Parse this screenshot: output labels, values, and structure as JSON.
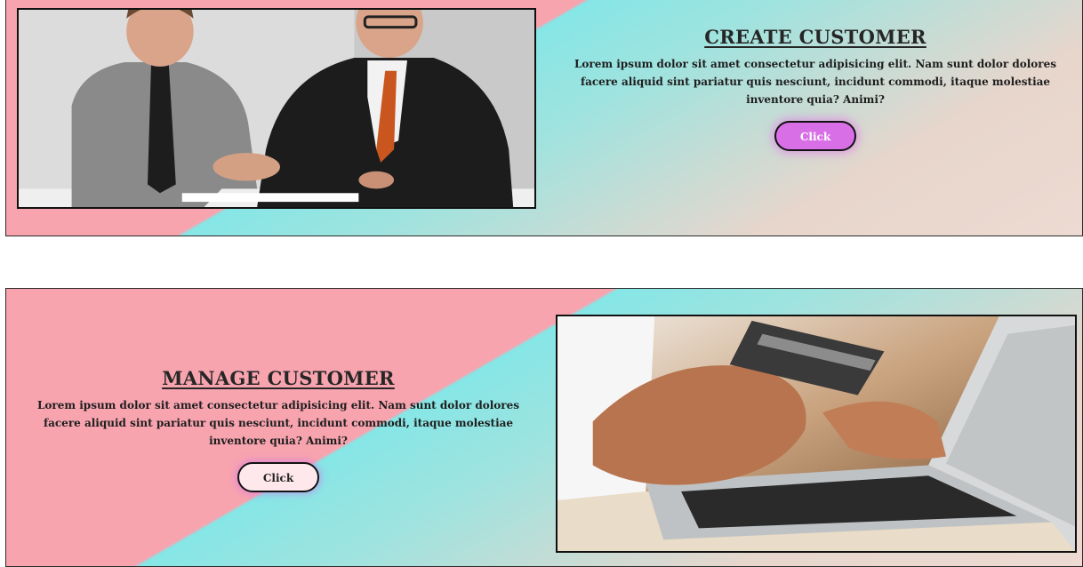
{
  "sections": [
    {
      "title": "CREATE CUSTOMER",
      "description": "Lorem ipsum dolor sit amet consectetur adipisicing elit. Nam sunt dolor dolores facere aliquid sint pariatur quis nesciunt, incidunt commodi, itaque molestiae inventore quia? Animi?",
      "button_label": "Click",
      "image": "handshake-photo"
    },
    {
      "title": "MANAGE CUSTOMER",
      "description": "Lorem ipsum dolor sit amet consectetur adipisicing elit. Nam sunt dolor dolores facere aliquid sint pariatur quis nesciunt, incidunt commodi, itaque molestiae inventore quia? Animi?",
      "button_label": "Click",
      "image": "credit-card-laptop-photo"
    }
  ],
  "colors": {
    "pink": "#f7a4af",
    "cyan": "#86e6e6",
    "beige": "#eddad2",
    "button_purple": "#d86fe6"
  }
}
